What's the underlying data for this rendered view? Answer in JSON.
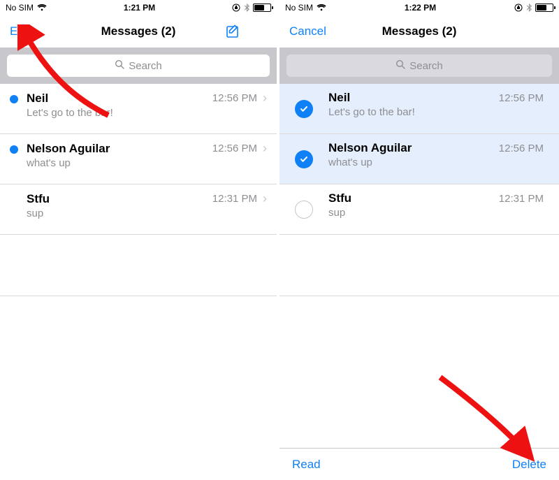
{
  "left": {
    "status": {
      "carrier": "No SIM",
      "time": "1:21 PM"
    },
    "nav": {
      "left": "Edit",
      "title": "Messages (2)"
    },
    "search": {
      "placeholder": "Search"
    },
    "rows": [
      {
        "sender": "Neil",
        "time": "12:56 PM",
        "preview": "Let's go to the bar!"
      },
      {
        "sender": "Nelson Aguilar",
        "time": "12:56 PM",
        "preview": "what's up"
      },
      {
        "sender": "Stfu",
        "time": "12:31 PM",
        "preview": "sup"
      }
    ]
  },
  "right": {
    "status": {
      "carrier": "No SIM",
      "time": "1:22 PM"
    },
    "nav": {
      "left": "Cancel",
      "title": "Messages (2)"
    },
    "search": {
      "placeholder": "Search"
    },
    "rows": [
      {
        "sender": "Neil",
        "time": "12:56 PM",
        "preview": "Let's go to the bar!"
      },
      {
        "sender": "Nelson Aguilar",
        "time": "12:56 PM",
        "preview": "what's up"
      },
      {
        "sender": "Stfu",
        "time": "12:31 PM",
        "preview": "sup"
      }
    ],
    "toolbar": {
      "read": "Read",
      "delete": "Delete"
    }
  }
}
